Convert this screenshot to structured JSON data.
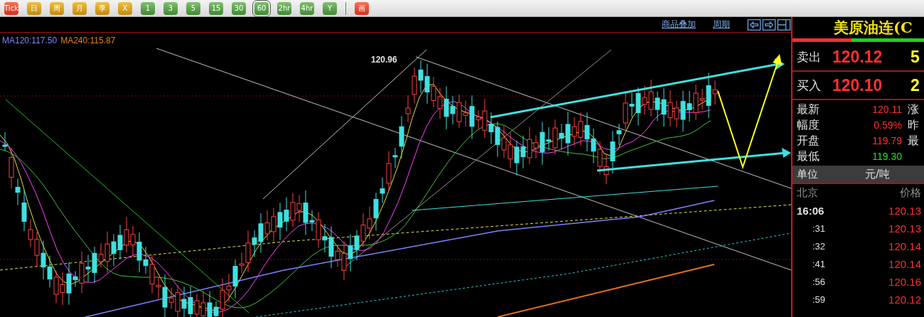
{
  "toolbar": {
    "buttons": [
      {
        "label": "Tick",
        "kind": "red",
        "selected": false
      },
      {
        "label": "日",
        "kind": "gold",
        "selected": false
      },
      {
        "label": "周",
        "kind": "gold",
        "selected": false
      },
      {
        "label": "月",
        "kind": "gold",
        "selected": false
      },
      {
        "label": "季",
        "kind": "gold",
        "selected": false
      },
      {
        "label": "X",
        "kind": "gold",
        "selected": false
      },
      {
        "label": "1",
        "kind": "green",
        "selected": false
      },
      {
        "label": "3",
        "kind": "green",
        "selected": false
      },
      {
        "label": "5",
        "kind": "green",
        "selected": false
      },
      {
        "label": "15",
        "kind": "green",
        "selected": false
      },
      {
        "label": "30",
        "kind": "green",
        "selected": false
      },
      {
        "label": "60",
        "kind": "green",
        "selected": true
      },
      {
        "label": "2hr",
        "kind": "green",
        "selected": false
      },
      {
        "label": "4hr",
        "kind": "green",
        "selected": false
      },
      {
        "label": "Y",
        "kind": "green",
        "selected": false
      }
    ],
    "draw_button": {
      "label": "画",
      "kind": "red"
    }
  },
  "chart_header": {
    "links": [
      "商品叠加",
      "周期"
    ]
  },
  "indicators": [
    {
      "text": "MA120:117.50",
      "color": "#8080ff"
    },
    {
      "text": "MA240:115.87",
      "color": "#e08020"
    }
  ],
  "chart": {
    "high_label": "120.96"
  },
  "quote": {
    "title": "美原油连(C",
    "book": [
      {
        "label": "卖出",
        "price": "120.12",
        "volume": "5"
      },
      {
        "label": "买入",
        "price": "120.10",
        "volume": "2"
      }
    ],
    "stats": [
      {
        "label": "最新",
        "value": "120.11",
        "color": "#ff3030",
        "side_label": "涨"
      },
      {
        "label": "幅度",
        "value": "0.59%",
        "color": "#ff3030",
        "side_label": "昨"
      },
      {
        "label": "开盘",
        "value": "119.79",
        "color": "#ff3030",
        "side_label": "最"
      },
      {
        "label": "最低",
        "value": "119.30",
        "color": "#20e020"
      }
    ],
    "unit": {
      "label": "单位",
      "value": "元/吨"
    },
    "ticks_header": {
      "time": "北京",
      "price": "价格"
    },
    "ticks": [
      {
        "time": "16:06",
        "price": "120.13"
      },
      {
        "time": ":31",
        "price": "120.13"
      },
      {
        "time": ":32",
        "price": "120.14"
      },
      {
        "time": ":41",
        "price": "120.14"
      },
      {
        "time": ":56",
        "price": "120.16"
      },
      {
        "time": ":59",
        "price": "120.12"
      }
    ]
  }
}
